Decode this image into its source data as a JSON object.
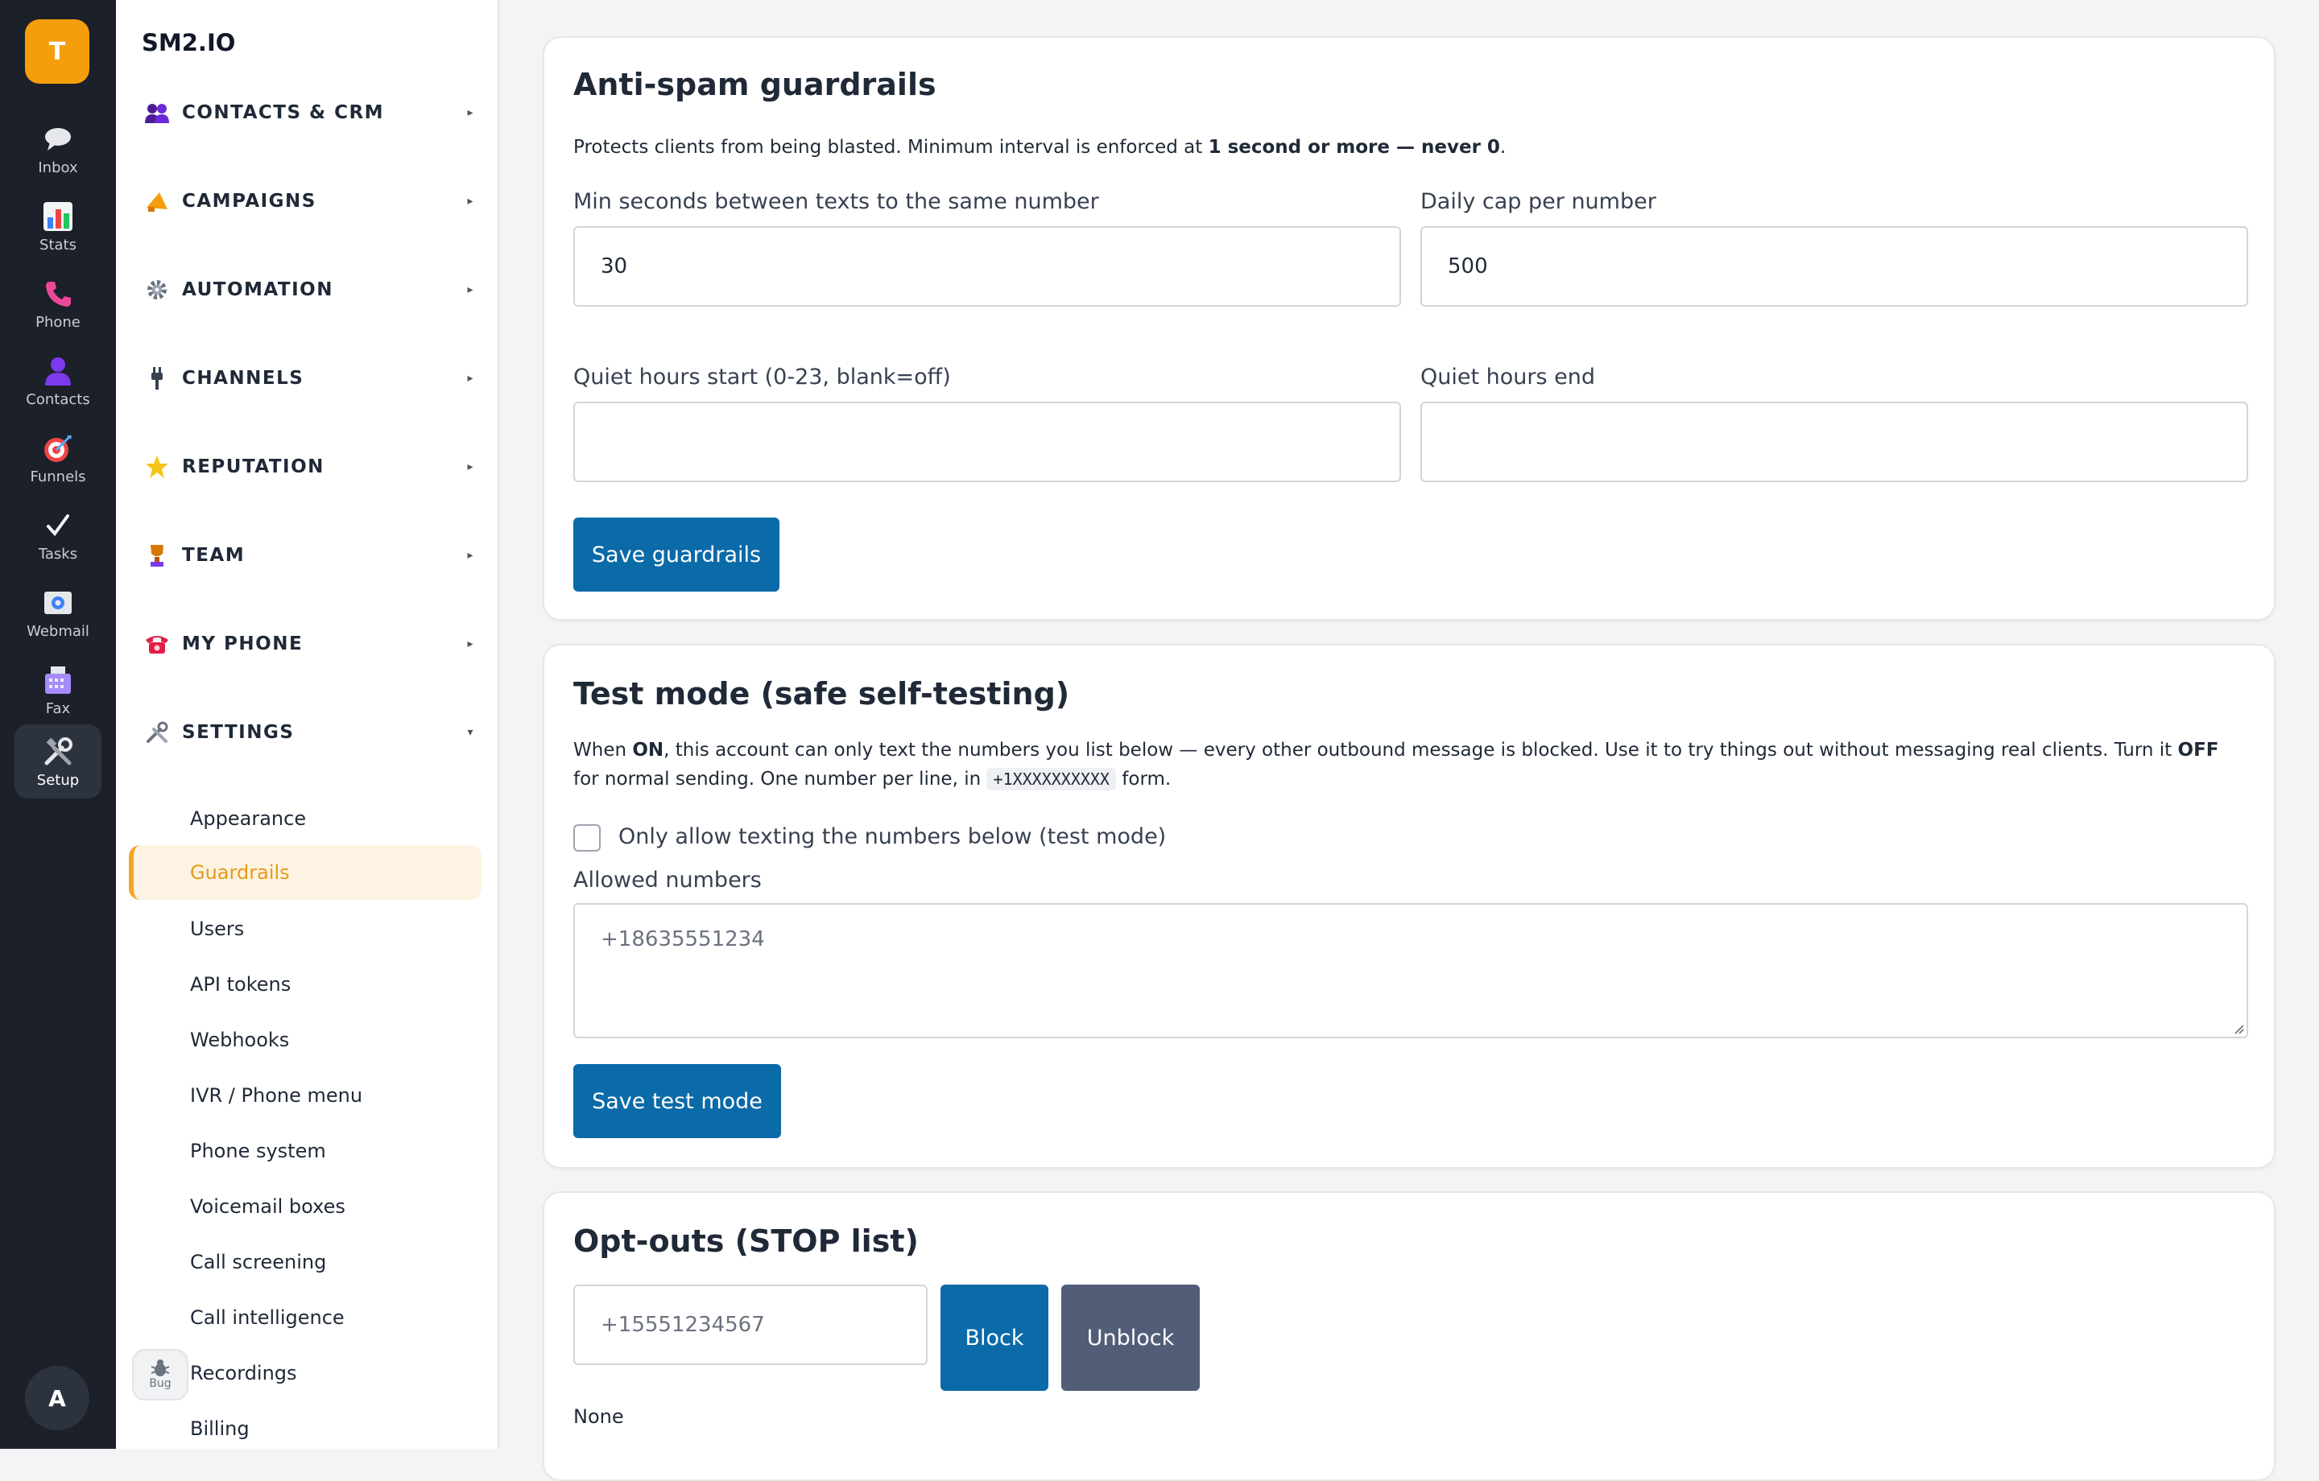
{
  "rail": {
    "logo_letter": "T",
    "items": [
      {
        "label": "Inbox",
        "icon": "speech-bubble-icon"
      },
      {
        "label": "Stats",
        "icon": "bar-chart-icon"
      },
      {
        "label": "Phone",
        "icon": "phone-icon"
      },
      {
        "label": "Contacts",
        "icon": "person-icon"
      },
      {
        "label": "Funnels",
        "icon": "target-icon"
      },
      {
        "label": "Tasks",
        "icon": "check-icon"
      },
      {
        "label": "Webmail",
        "icon": "email-icon"
      },
      {
        "label": "Fax",
        "icon": "fax-icon"
      },
      {
        "label": "Setup",
        "icon": "tools-icon"
      }
    ],
    "active": "Setup",
    "avatar_letter": "A"
  },
  "sidenav": {
    "brand": "SM2.IO",
    "groups": [
      {
        "label": "CONTACTS & CRM",
        "icon": "people-icon"
      },
      {
        "label": "CAMPAIGNS",
        "icon": "megaphone-icon"
      },
      {
        "label": "AUTOMATION",
        "icon": "gear-icon"
      },
      {
        "label": "CHANNELS",
        "icon": "plug-icon"
      },
      {
        "label": "REPUTATION",
        "icon": "star-icon"
      },
      {
        "label": "TEAM",
        "icon": "trophy-icon"
      },
      {
        "label": "MY PHONE",
        "icon": "telephone-icon"
      },
      {
        "label": "SETTINGS",
        "icon": "tools-icon"
      }
    ],
    "settings_items": [
      "Appearance",
      "Guardrails",
      "Users",
      "API tokens",
      "Webhooks",
      "IVR / Phone menu",
      "Phone system",
      "Voicemail boxes",
      "Call screening",
      "Call intelligence",
      "Recordings",
      "Billing"
    ],
    "active_item": "Guardrails",
    "bug_label": "Bug"
  },
  "guardrails": {
    "title": "Anti-spam guardrails",
    "desc_prefix": "Protects clients from being blasted. Minimum interval is enforced at ",
    "desc_bold": "1 second or more — never 0",
    "desc_suffix": ".",
    "min_seconds_label": "Min seconds between texts to the same number",
    "min_seconds_value": "30",
    "daily_cap_label": "Daily cap per number",
    "daily_cap_value": "500",
    "quiet_start_label": "Quiet hours start (0-23, blank=off)",
    "quiet_start_value": "",
    "quiet_end_label": "Quiet hours end",
    "quiet_end_value": "",
    "save_label": "Save guardrails"
  },
  "test_mode": {
    "title": "Test mode (safe self-testing)",
    "desc_1": "When ",
    "desc_on": "ON",
    "desc_2": ", this account can only text the numbers you list below — every other outbound message is blocked. Use it to try things out without messaging real clients. Turn it ",
    "desc_off": "OFF",
    "desc_3": " for normal sending. One number per line, in ",
    "desc_code": "+1XXXXXXXXXX",
    "desc_4": " form.",
    "checkbox_label": "Only allow texting the numbers below (test mode)",
    "checkbox_checked": false,
    "allowed_label": "Allowed numbers",
    "allowed_placeholder": "+18635551234",
    "save_label": "Save test mode"
  },
  "optouts": {
    "title": "Opt-outs (STOP list)",
    "input_placeholder": "+15551234567",
    "block_label": "Block",
    "unblock_label": "Unblock",
    "list_text": "None"
  }
}
